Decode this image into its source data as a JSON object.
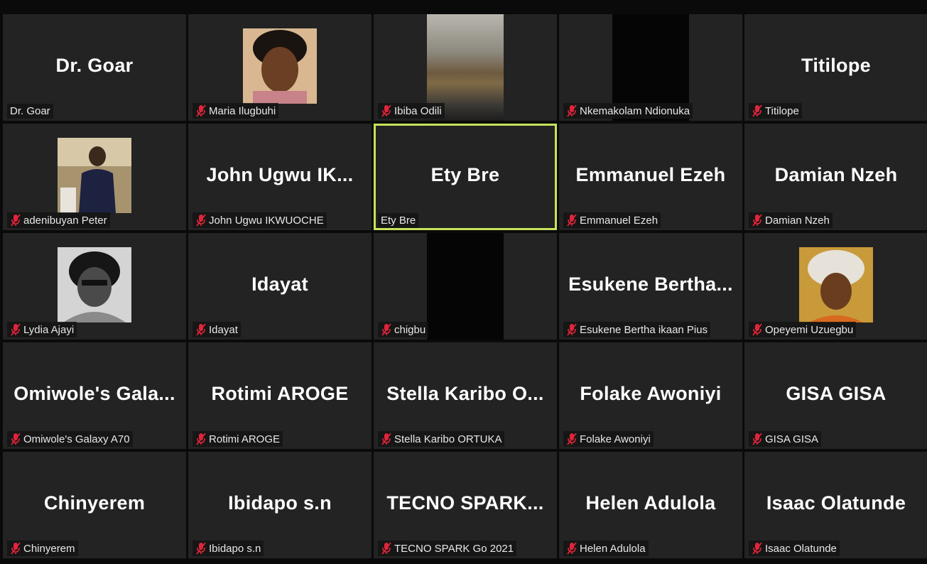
{
  "participants": [
    {
      "display": "Dr. Goar",
      "label": "Dr. Goar",
      "muted": false,
      "media": "none"
    },
    {
      "display": "",
      "label": "Maria Ilugbuhi",
      "muted": true,
      "media": "photo"
    },
    {
      "display": "",
      "label": "Ibiba Odili",
      "muted": true,
      "media": "video"
    },
    {
      "display": "",
      "label": "Nkemakolam Ndionuka",
      "muted": true,
      "media": "video"
    },
    {
      "display": "Titilope",
      "label": "Titilope",
      "muted": true,
      "media": "none"
    },
    {
      "display": "",
      "label": "adenibuyan Peter",
      "muted": true,
      "media": "photo"
    },
    {
      "display": "John Ugwu IK...",
      "label": "John Ugwu IKWUOCHE",
      "muted": true,
      "media": "none"
    },
    {
      "display": "Ety Bre",
      "label": "Ety Bre",
      "muted": false,
      "media": "none",
      "active_speaker": true
    },
    {
      "display": "Emmanuel Ezeh",
      "label": "Emmanuel Ezeh",
      "muted": true,
      "media": "none"
    },
    {
      "display": "Damian Nzeh",
      "label": "Damian Nzeh",
      "muted": true,
      "media": "none"
    },
    {
      "display": "",
      "label": "Lydia Ajayi",
      "muted": true,
      "media": "photo"
    },
    {
      "display": "Idayat",
      "label": "Idayat",
      "muted": true,
      "media": "none"
    },
    {
      "display": "",
      "label": "chigbu",
      "muted": true,
      "media": "video"
    },
    {
      "display": "Esukene Bertha...",
      "label": "Esukene Bertha ikaan Pius",
      "muted": true,
      "media": "none"
    },
    {
      "display": "",
      "label": "Opeyemi Uzuegbu",
      "muted": true,
      "media": "photo"
    },
    {
      "display": "Omiwole's Gala...",
      "label": "Omiwole's Galaxy A70",
      "muted": true,
      "media": "none"
    },
    {
      "display": "Rotimi AROGE",
      "label": "Rotimi AROGE",
      "muted": true,
      "media": "none"
    },
    {
      "display": "Stella Karibo O...",
      "label": "Stella Karibo ORTUKA",
      "muted": true,
      "media": "none"
    },
    {
      "display": "Folake Awoniyi",
      "label": "Folake Awoniyi",
      "muted": true,
      "media": "none"
    },
    {
      "display": "GISA GISA",
      "label": "GISA GISA",
      "muted": true,
      "media": "none"
    },
    {
      "display": "Chinyerem",
      "label": "Chinyerem",
      "muted": true,
      "media": "none"
    },
    {
      "display": "Ibidapo s.n",
      "label": "Ibidapo s.n",
      "muted": true,
      "media": "none"
    },
    {
      "display": "TECNO SPARK...",
      "label": "TECNO SPARK Go 2021",
      "muted": true,
      "media": "none"
    },
    {
      "display": "Helen Adulola",
      "label": "Helen Adulola",
      "muted": true,
      "media": "none"
    },
    {
      "display": "Isaac Olatunde",
      "label": "Isaac Olatunde",
      "muted": true,
      "media": "none"
    }
  ],
  "colors": {
    "active_speaker_border": "#c6e35a",
    "muted_icon": "#e0243a",
    "tile_bg": "#232323"
  }
}
